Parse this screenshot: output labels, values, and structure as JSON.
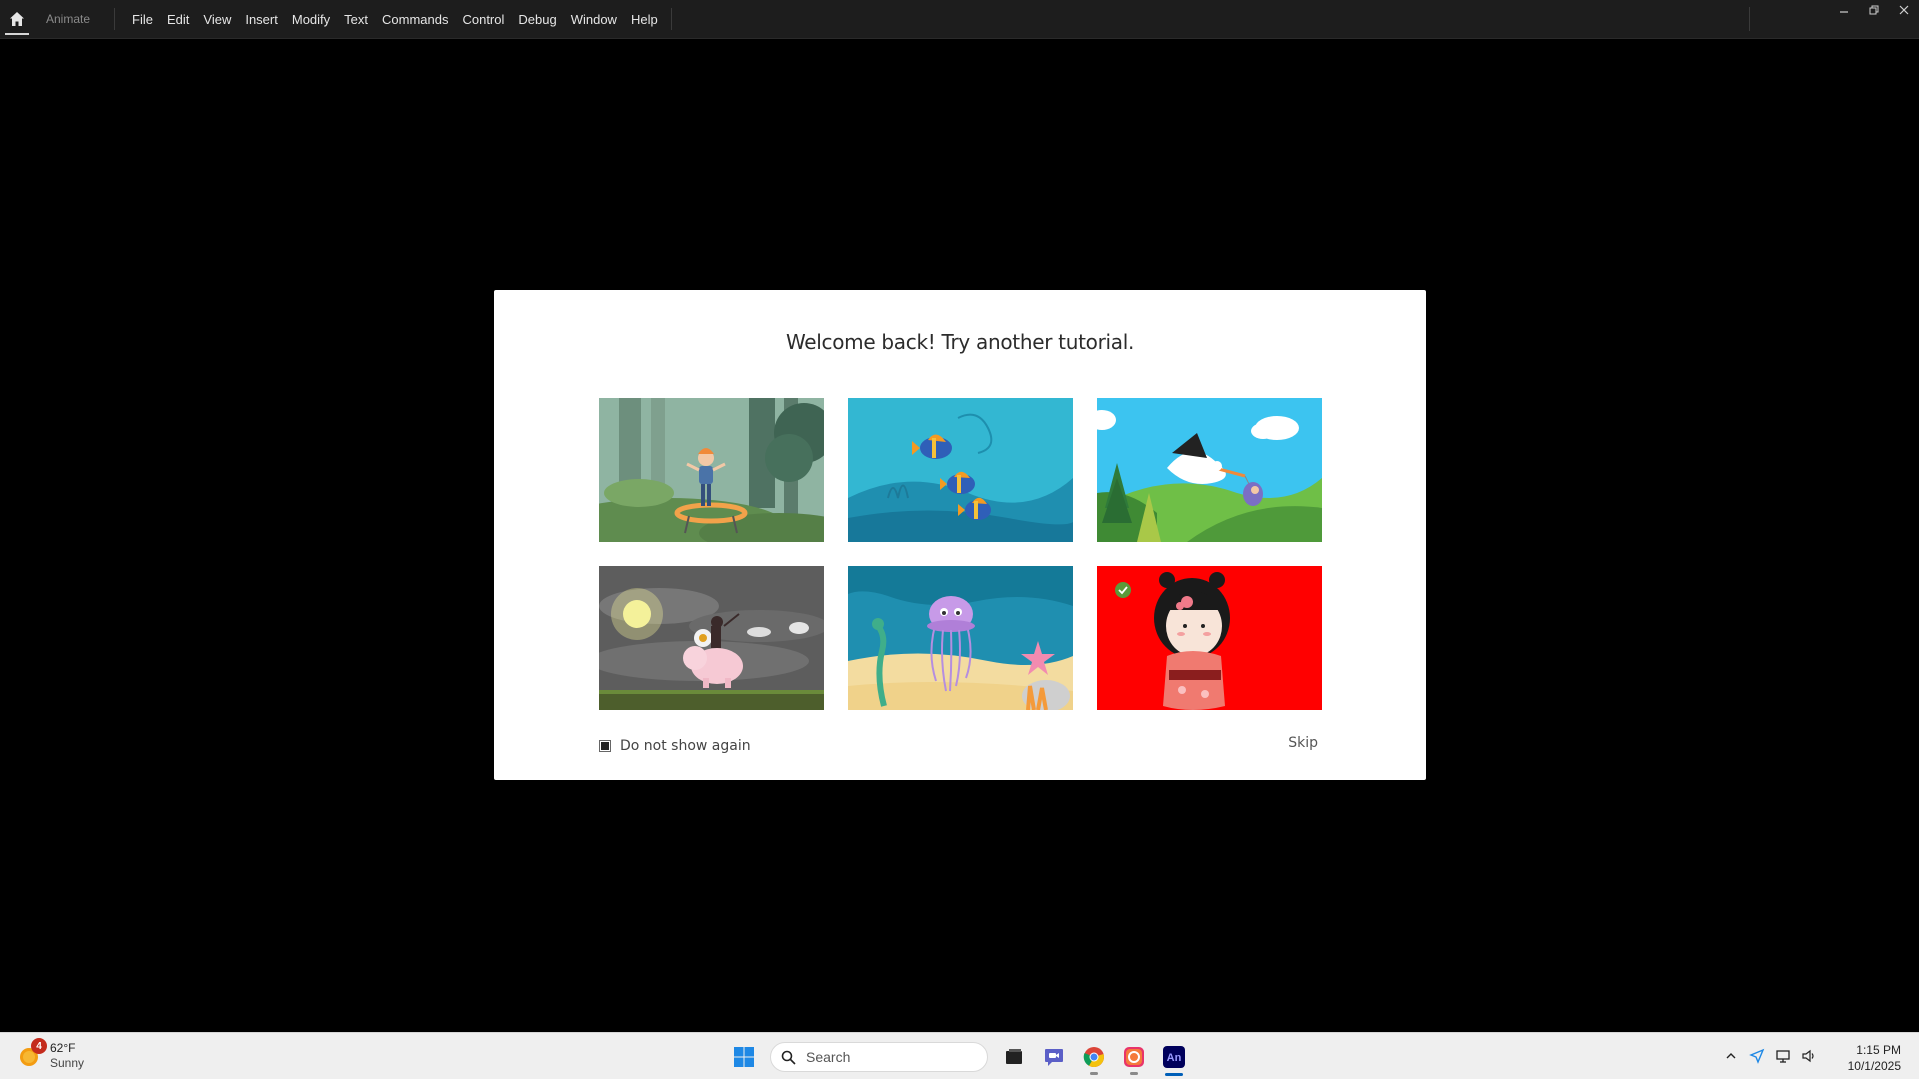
{
  "app": {
    "name": "Animate",
    "menu": [
      "File",
      "Edit",
      "View",
      "Insert",
      "Modify",
      "Text",
      "Commands",
      "Control",
      "Debug",
      "Window",
      "Help"
    ]
  },
  "dialog": {
    "title": "Welcome back! Try another tutorial.",
    "tutorials": [
      {
        "id": "trampoline-girl",
        "completed": false
      },
      {
        "id": "fish-school",
        "completed": false
      },
      {
        "id": "stork-delivery",
        "completed": false
      },
      {
        "id": "pig-rider",
        "completed": false
      },
      {
        "id": "jellyfish-underwater",
        "completed": false
      },
      {
        "id": "kokeshi-doll",
        "completed": true
      }
    ],
    "do_not_show_label": "Do not show again",
    "skip_label": "Skip"
  },
  "taskbar": {
    "weather": {
      "temp": "62°F",
      "condition": "Sunny",
      "badge": "4"
    },
    "search_placeholder": "Search",
    "pinned": [
      "task-view",
      "meet",
      "chrome",
      "creative-cloud",
      "animate"
    ],
    "clock": {
      "time": "1:15 PM",
      "date": "10/1/2025"
    }
  },
  "colors": {
    "menubar": "#1d1d1d",
    "dialog_bg": "#ffffff",
    "taskbar": "#efefef",
    "accent": "#005fb8"
  }
}
